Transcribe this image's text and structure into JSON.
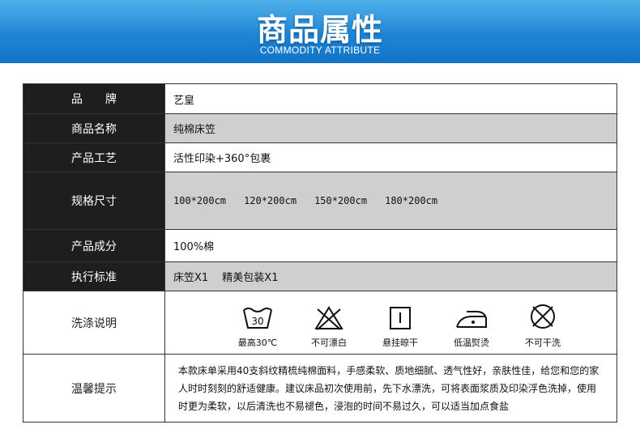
{
  "banner": {
    "title": "商品属性",
    "subtitle": "COMMODITY ATTRIBUTE",
    "colors": {
      "top": "#4fb0ea",
      "bottom": "#1274c6"
    }
  },
  "attributes": {
    "brand": {
      "label": "品　　牌",
      "value": "艺皇"
    },
    "product_name": {
      "label": "商品名称",
      "value": "纯棉床笠"
    },
    "craft": {
      "label": "产品工艺",
      "value": "活性印染+360°包裹"
    },
    "sizes": {
      "label": "规格尺寸",
      "values": [
        "100*200cm",
        "120*200cm",
        "150*200cm",
        "180*200cm"
      ]
    },
    "composition": {
      "label": "产品成分",
      "value": "100%棉"
    },
    "standard": {
      "label": "执行标准",
      "value": "床笠X1　 精美包装X1"
    },
    "washing": {
      "label": "洗涤说明",
      "items": [
        {
          "icon": "wash-30-icon",
          "text": "最高30℃",
          "number": "30"
        },
        {
          "icon": "no-bleach-icon",
          "text": "不可漂白"
        },
        {
          "icon": "hang-dry-icon",
          "text": "悬挂晾干"
        },
        {
          "icon": "low-iron-icon",
          "text": "低温熨烫"
        },
        {
          "icon": "no-dry-clean-icon",
          "text": "不可干洗"
        }
      ]
    },
    "tips": {
      "label": "温馨提示",
      "text": "本款床单采用40支斜纹精梳纯棉面料，手感柔软、质地细腻、透气性好，亲肤性佳，给您和您的家人时时刻刻的舒适健康。建议床品初次使用前，先下水漂洗，可将表面浆质及印染浮色洗掉，使用时更为柔软，以后清洗也不易褪色，浸泡的时间不易过久，可以适当加点食盐"
    }
  }
}
